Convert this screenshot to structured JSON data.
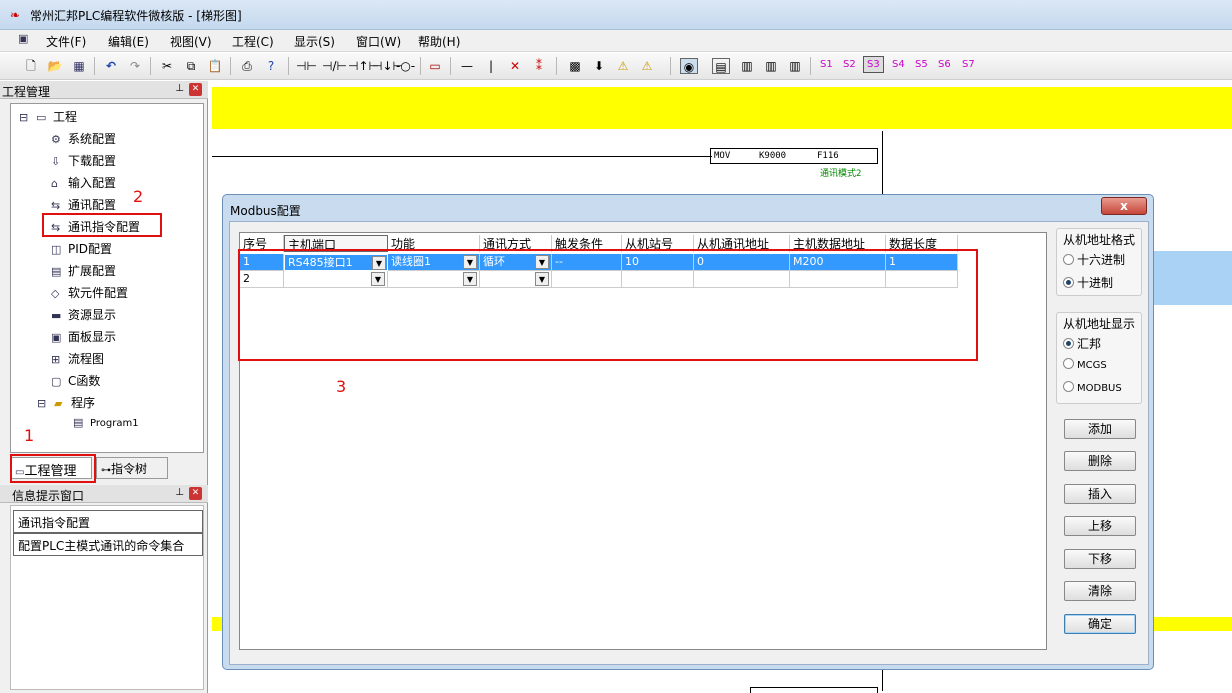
{
  "window": {
    "title": "常州汇邦PLC编程软件微核版 - [梯形图]"
  },
  "menu": [
    "文件(F)",
    "编辑(E)",
    "视图(V)",
    "工程(C)",
    "显示(S)",
    "窗口(W)",
    "帮助(H)"
  ],
  "toolbar": {
    "stations": [
      "S1",
      "S2",
      "S3",
      "S4",
      "S5",
      "S6",
      "S7"
    ],
    "active_station": "S3"
  },
  "project_panel": {
    "title": "工程管理",
    "root": "工程",
    "items": [
      "系统配置",
      "下载配置",
      "输入配置",
      "通讯配置",
      "通讯指令配置",
      "PID配置",
      "扩展配置",
      "软元件配置",
      "资源显示",
      "面板显示",
      "流程图",
      "C函数",
      "程序"
    ],
    "program": "Program1",
    "tabs": [
      "工程管理",
      "指令树"
    ]
  },
  "info_panel": {
    "title": "信息提示窗口",
    "lines": [
      "通讯指令配置",
      "配置PLC主模式通讯的命令集合"
    ]
  },
  "ladder": {
    "mov_instruction": "MOV",
    "mov_src": "K9000",
    "mov_dst": "F116",
    "comment": "通讯模式2"
  },
  "annotations": {
    "one": "1",
    "two": "2",
    "three": "3"
  },
  "dialog": {
    "title": "Modbus配置",
    "close": "x",
    "columns": [
      "序号",
      "主机端口",
      "功能",
      "通讯方式",
      "触发条件",
      "从机站号",
      "从机通讯地址",
      "主机数据地址",
      "数据长度"
    ],
    "rows": [
      {
        "no": "1",
        "port": "RS485接口1",
        "func": "读线圈1",
        "mode": "循环",
        "trigger": "--",
        "station": "10",
        "slave_addr": "0",
        "master_addr": "M200",
        "length": "1"
      },
      {
        "no": "2",
        "port": "",
        "func": "",
        "mode": "",
        "trigger": "",
        "station": "",
        "slave_addr": "",
        "master_addr": "",
        "length": ""
      }
    ],
    "addr_format": {
      "title": "从机地址格式",
      "options": [
        "十六进制",
        "十进制"
      ],
      "selected": "十进制"
    },
    "addr_display": {
      "title": "从机地址显示",
      "options": [
        "汇邦",
        "MCGS",
        "MODBUS"
      ],
      "selected": "汇邦"
    },
    "buttons": [
      "添加",
      "删除",
      "插入",
      "上移",
      "下移",
      "清除",
      "确定"
    ]
  }
}
